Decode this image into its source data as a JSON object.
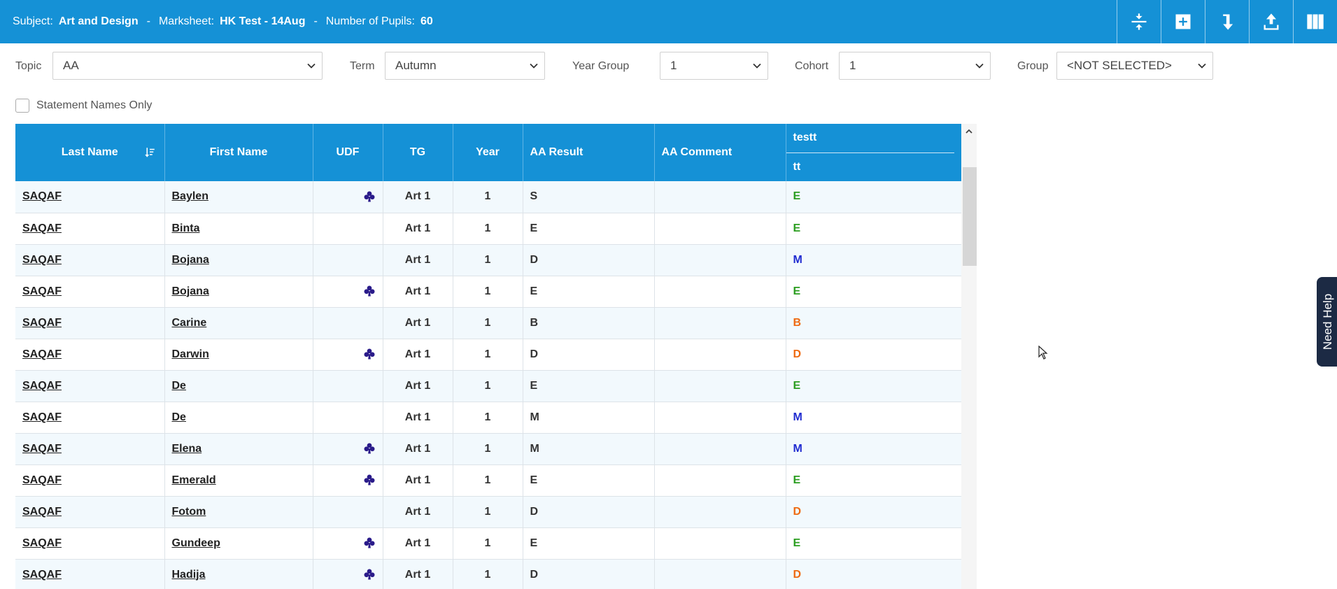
{
  "header": {
    "subject_label": "Subject:",
    "subject_value": "Art and Design",
    "marksheet_label": "Marksheet:",
    "marksheet_value": "HK Test - 14Aug",
    "pupils_label": "Number of Pupils:",
    "pupils_value": "60",
    "separator": "-",
    "actions": [
      "compress-icon",
      "add-icon",
      "arrow-down-icon",
      "upload-icon",
      "columns-icon"
    ]
  },
  "filters": {
    "topic_label": "Topic",
    "topic_value": "AA",
    "term_label": "Term",
    "term_value": "Autumn",
    "year_group_label": "Year Group",
    "year_group_value": "1",
    "cohort_label": "Cohort",
    "cohort_value": "1",
    "group_label": "Group",
    "group_value": "<NOT SELECTED>"
  },
  "options": {
    "statement_names_only": "Statement Names Only",
    "statement_names_only_checked": false
  },
  "table": {
    "columns": {
      "last_name": "Last Name",
      "first_name": "First Name",
      "udf": "UDF",
      "tg": "TG",
      "year": "Year",
      "aa_result": "AA Result",
      "aa_comment": "AA Comment",
      "group_top": "testt",
      "group_bottom": "tt"
    },
    "rows": [
      {
        "last": "SAQAF",
        "first": "Baylen",
        "udf": true,
        "tg": "Art 1",
        "year": "1",
        "result": "S",
        "comment": "",
        "tt": "E",
        "tt_color": "green"
      },
      {
        "last": "SAQAF",
        "first": "Binta",
        "udf": false,
        "tg": "Art 1",
        "year": "1",
        "result": "E",
        "comment": "",
        "tt": "E",
        "tt_color": "green"
      },
      {
        "last": "SAQAF",
        "first": "Bojana",
        "udf": false,
        "tg": "Art 1",
        "year": "1",
        "result": "D",
        "comment": "",
        "tt": "M",
        "tt_color": "blue"
      },
      {
        "last": "SAQAF",
        "first": "Bojana",
        "udf": true,
        "tg": "Art 1",
        "year": "1",
        "result": "E",
        "comment": "",
        "tt": "E",
        "tt_color": "green"
      },
      {
        "last": "SAQAF",
        "first": "Carine",
        "udf": false,
        "tg": "Art 1",
        "year": "1",
        "result": "B",
        "comment": "",
        "tt": "B",
        "tt_color": "orange"
      },
      {
        "last": "SAQAF",
        "first": "Darwin",
        "udf": true,
        "tg": "Art 1",
        "year": "1",
        "result": "D",
        "comment": "",
        "tt": "D",
        "tt_color": "orange"
      },
      {
        "last": "SAQAF",
        "first": "De",
        "udf": false,
        "tg": "Art 1",
        "year": "1",
        "result": "E",
        "comment": "",
        "tt": "E",
        "tt_color": "green"
      },
      {
        "last": "SAQAF",
        "first": "De",
        "udf": false,
        "tg": "Art 1",
        "year": "1",
        "result": "M",
        "comment": "",
        "tt": "M",
        "tt_color": "blue"
      },
      {
        "last": "SAQAF",
        "first": "Elena",
        "udf": true,
        "tg": "Art 1",
        "year": "1",
        "result": "M",
        "comment": "",
        "tt": "M",
        "tt_color": "blue"
      },
      {
        "last": "SAQAF",
        "first": "Emerald",
        "udf": true,
        "tg": "Art 1",
        "year": "1",
        "result": "E",
        "comment": "",
        "tt": "E",
        "tt_color": "green"
      },
      {
        "last": "SAQAF",
        "first": "Fotom",
        "udf": false,
        "tg": "Art 1",
        "year": "1",
        "result": "D",
        "comment": "",
        "tt": "D",
        "tt_color": "orange"
      },
      {
        "last": "SAQAF",
        "first": "Gundeep",
        "udf": true,
        "tg": "Art 1",
        "year": "1",
        "result": "E",
        "comment": "",
        "tt": "E",
        "tt_color": "green"
      },
      {
        "last": "SAQAF",
        "first": "Hadija",
        "udf": true,
        "tg": "Art 1",
        "year": "1",
        "result": "D",
        "comment": "",
        "tt": "D",
        "tt_color": "orange"
      }
    ]
  },
  "help_tab": "Need Help",
  "colors": {
    "header_blue": "#1591d6",
    "grade_green": "#2a9d1f",
    "grade_blue": "#1f2bd0",
    "grade_orange": "#ee6a12",
    "udf_icon": "#2a1b8a"
  }
}
